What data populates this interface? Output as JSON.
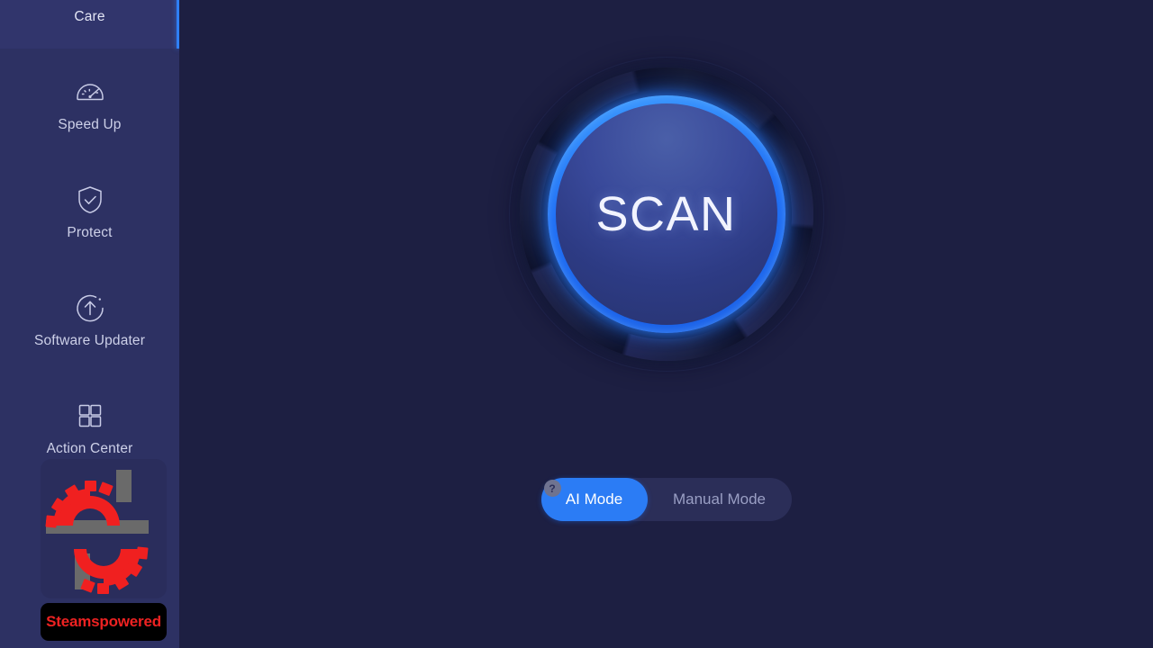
{
  "app": {
    "name": "Care",
    "background_color": "#1d1f42",
    "sidebar_color": "#2d3163",
    "accent_color": "#2b7cf5"
  },
  "sidebar": {
    "active_indicator_color": "#2f7ff5",
    "items": [
      {
        "id": "care",
        "label": "Care",
        "icon": "care-arcs-icon",
        "active": true
      },
      {
        "id": "speed-up",
        "label": "Speed Up",
        "icon": "speedometer-icon",
        "active": false
      },
      {
        "id": "protect",
        "label": "Protect",
        "icon": "shield-check-icon",
        "active": false
      },
      {
        "id": "software-updater",
        "label": "Software Updater",
        "icon": "arrow-up-circle-icon",
        "active": false
      },
      {
        "id": "action-center",
        "label": "Action Center",
        "icon": "grid-squares-icon",
        "active": false
      }
    ]
  },
  "main": {
    "scan_button": {
      "label": "SCAN",
      "ring_color": "#2b7cf5",
      "face_color": "#39499a"
    },
    "mode_toggle": {
      "help_glyph": "?",
      "options": [
        {
          "id": "ai-mode",
          "label": "AI Mode",
          "selected": true
        },
        {
          "id": "manual-mode",
          "label": "Manual Mode",
          "selected": false
        }
      ]
    }
  },
  "watermark": {
    "caption": "Steamspowered",
    "caption_color": "#ee2222",
    "gear_color": "#f02020",
    "bar_color": "#6a6a6a"
  }
}
